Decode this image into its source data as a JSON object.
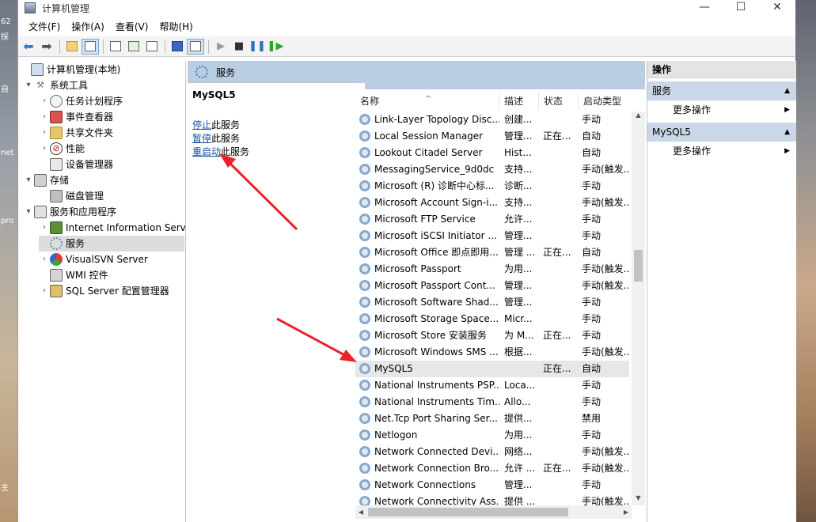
{
  "window": {
    "title": "计算机管理",
    "min": "—",
    "max": "☐",
    "close": "✕"
  },
  "desktop": {
    "left_labels": [
      "62",
      "採",
      "自",
      "net",
      "pro",
      "主"
    ]
  },
  "menu": [
    "文件(F)",
    "操作(A)",
    "查看(V)",
    "帮助(H)"
  ],
  "toolbar": [
    "back",
    "forward",
    "up-folder",
    "show-tree",
    "properties",
    "refresh",
    "export",
    "help",
    "show-action-pane",
    "start",
    "stop",
    "pause",
    "resume"
  ],
  "tree": [
    {
      "label": "计算机管理(本地)",
      "icon": "computer-icon",
      "level": 0,
      "arrow": ""
    },
    {
      "label": "系统工具",
      "icon": "tools-icon",
      "level": 1,
      "arrow": "▾"
    },
    {
      "label": "任务计划程序",
      "icon": "clock-icon",
      "level": 2,
      "arrow": "›"
    },
    {
      "label": "事件查看器",
      "icon": "event-viewer-icon",
      "level": 2,
      "arrow": "›"
    },
    {
      "label": "共享文件夹",
      "icon": "shared-folder-icon",
      "level": 2,
      "arrow": "›"
    },
    {
      "label": "性能",
      "icon": "performance-icon",
      "level": 2,
      "arrow": "›"
    },
    {
      "label": "设备管理器",
      "icon": "device-manager-icon",
      "level": 2,
      "arrow": ""
    },
    {
      "label": "存储",
      "icon": "storage-icon",
      "level": 1,
      "arrow": "▾"
    },
    {
      "label": "磁盘管理",
      "icon": "disk-icon",
      "level": 2,
      "arrow": ""
    },
    {
      "label": "服务和应用程序",
      "icon": "services-apps-icon",
      "level": 1,
      "arrow": "▾"
    },
    {
      "label": "Internet Information Serv",
      "icon": "iis-icon",
      "level": 2,
      "arrow": "›"
    },
    {
      "label": "服务",
      "icon": "services-icon",
      "level": 2,
      "arrow": "",
      "selected": true
    },
    {
      "label": "VisualSVN Server",
      "icon": "visualsvn-icon",
      "level": 2,
      "arrow": "›"
    },
    {
      "label": "WMI 控件",
      "icon": "wmi-icon",
      "level": 2,
      "arrow": ""
    },
    {
      "label": "SQL Server 配置管理器",
      "icon": "sql-config-icon",
      "level": 2,
      "arrow": "›"
    }
  ],
  "middle": {
    "header": "服务",
    "selected_service": "MySQL5",
    "links": [
      {
        "link": "停止",
        "rest": "此服务"
      },
      {
        "link": "暂停",
        "rest": "此服务"
      },
      {
        "link": "重启动",
        "rest": "此服务"
      }
    ]
  },
  "columns": [
    "名称",
    "描述",
    "状态",
    "启动类型"
  ],
  "services": [
    {
      "name": "Link-Layer Topology Disc...",
      "desc": "创建...",
      "status": "",
      "type": "手动"
    },
    {
      "name": "Local Session Manager",
      "desc": "管理...",
      "status": "正在...",
      "type": "自动"
    },
    {
      "name": "Lookout Citadel Server",
      "desc": "Hist...",
      "status": "",
      "type": "自动"
    },
    {
      "name": "MessagingService_9d0dc",
      "desc": "支持...",
      "status": "",
      "type": "手动(触发..."
    },
    {
      "name": "Microsoft (R) 诊断中心标...",
      "desc": "诊断...",
      "status": "",
      "type": "手动"
    },
    {
      "name": "Microsoft Account Sign-i...",
      "desc": "支持...",
      "status": "",
      "type": "手动(触发..."
    },
    {
      "name": "Microsoft FTP Service",
      "desc": "允许...",
      "status": "",
      "type": "手动"
    },
    {
      "name": "Microsoft iSCSI Initiator ...",
      "desc": "管理...",
      "status": "",
      "type": "手动"
    },
    {
      "name": "Microsoft Office 即点即用...",
      "desc": "管理 ...",
      "status": "正在...",
      "type": "自动"
    },
    {
      "name": "Microsoft Passport",
      "desc": "为用...",
      "status": "",
      "type": "手动(触发..."
    },
    {
      "name": "Microsoft Passport Cont...",
      "desc": "管理...",
      "status": "",
      "type": "手动(触发..."
    },
    {
      "name": "Microsoft Software Shad...",
      "desc": "管理...",
      "status": "",
      "type": "手动"
    },
    {
      "name": "Microsoft Storage Space...",
      "desc": "Micr...",
      "status": "",
      "type": "手动"
    },
    {
      "name": "Microsoft Store 安装服务",
      "desc": "为 M...",
      "status": "正在...",
      "type": "手动"
    },
    {
      "name": "Microsoft Windows SMS ...",
      "desc": "根据...",
      "status": "",
      "type": "手动(触发..."
    },
    {
      "name": "MySQL5",
      "desc": "",
      "status": "正在...",
      "type": "自动",
      "highlight": true
    },
    {
      "name": "National Instruments PSP...",
      "desc": "Loca...",
      "status": "",
      "type": "手动"
    },
    {
      "name": "National Instruments Tim...",
      "desc": "Allo...",
      "status": "",
      "type": "手动"
    },
    {
      "name": "Net.Tcp Port Sharing Ser...",
      "desc": "提供...",
      "status": "",
      "type": "禁用"
    },
    {
      "name": "Netlogon",
      "desc": "为用...",
      "status": "",
      "type": "手动"
    },
    {
      "name": "Network Connected Devi...",
      "desc": "网络...",
      "status": "",
      "type": "手动(触发..."
    },
    {
      "name": "Network Connection Bro...",
      "desc": "允许 ...",
      "status": "正在...",
      "type": "手动(触发..."
    },
    {
      "name": "Network Connections",
      "desc": "管理...",
      "status": "",
      "type": "手动"
    },
    {
      "name": "Network Connectivity Ass...",
      "desc": "提供 ...",
      "status": "",
      "type": "手动(触发..."
    }
  ],
  "actions": {
    "title": "操作",
    "sections": [
      {
        "label": "服务",
        "more": "更多操作"
      },
      {
        "label": "MySQL5",
        "more": "更多操作"
      }
    ]
  },
  "colors": {
    "header_blue": "#b9cde3",
    "link_blue": "#1a4f9c",
    "arrow_red": "#e8232a"
  }
}
